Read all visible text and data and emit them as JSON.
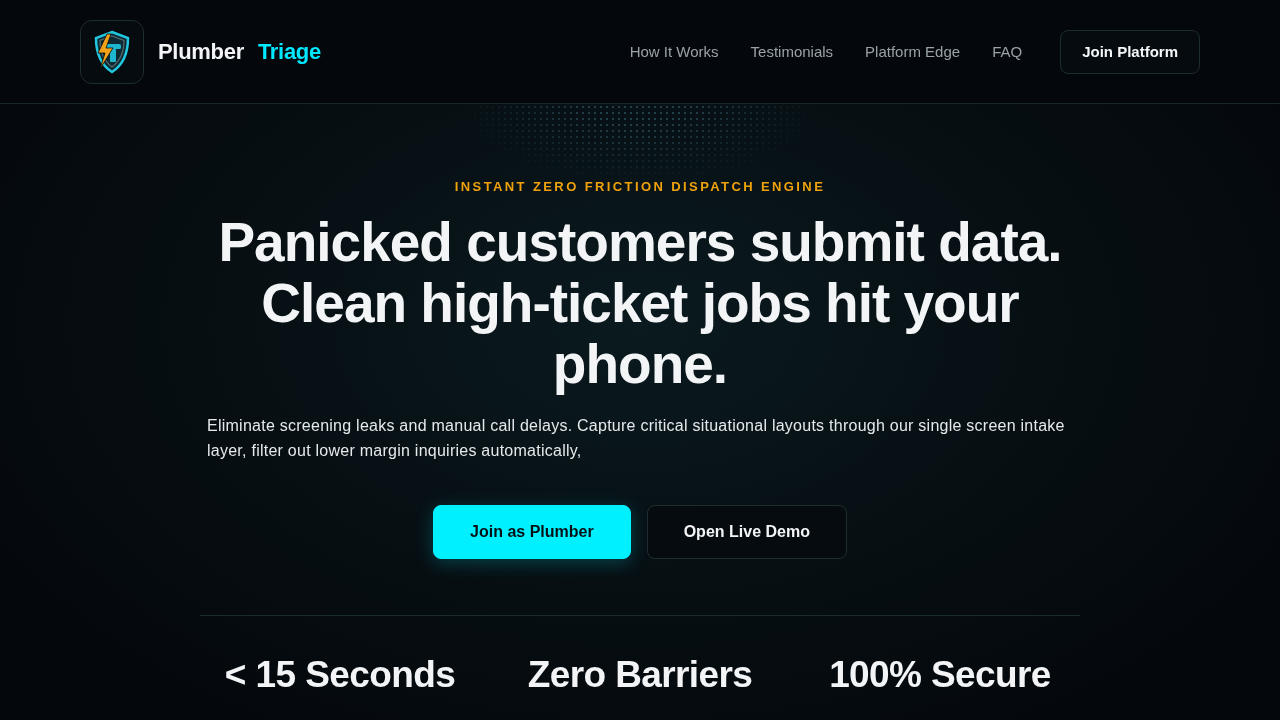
{
  "header": {
    "brand": {
      "name": "Plumber",
      "accent": "Triage"
    },
    "nav": [
      "How It Works",
      "Testimonials",
      "Platform Edge",
      "FAQ"
    ],
    "cta": "Join Platform"
  },
  "hero": {
    "eyebrow": "INSTANT ZERO FRICTION DISPATCH ENGINE",
    "headline": "Panicked customers submit data. Clean high-ticket jobs hit your phone.",
    "description": "Eliminate screening leaks and manual call delays. Capture critical situational layouts through our single screen intake layer, filter out lower margin inquiries automatically,",
    "buttons": [
      {
        "label": "Join as Plumber",
        "kind": "primary"
      },
      {
        "label": "Open Live Demo",
        "kind": "secondary"
      }
    ]
  },
  "stats": [
    "< 15 Seconds",
    "Zero Barriers",
    "100% Secure"
  ]
}
